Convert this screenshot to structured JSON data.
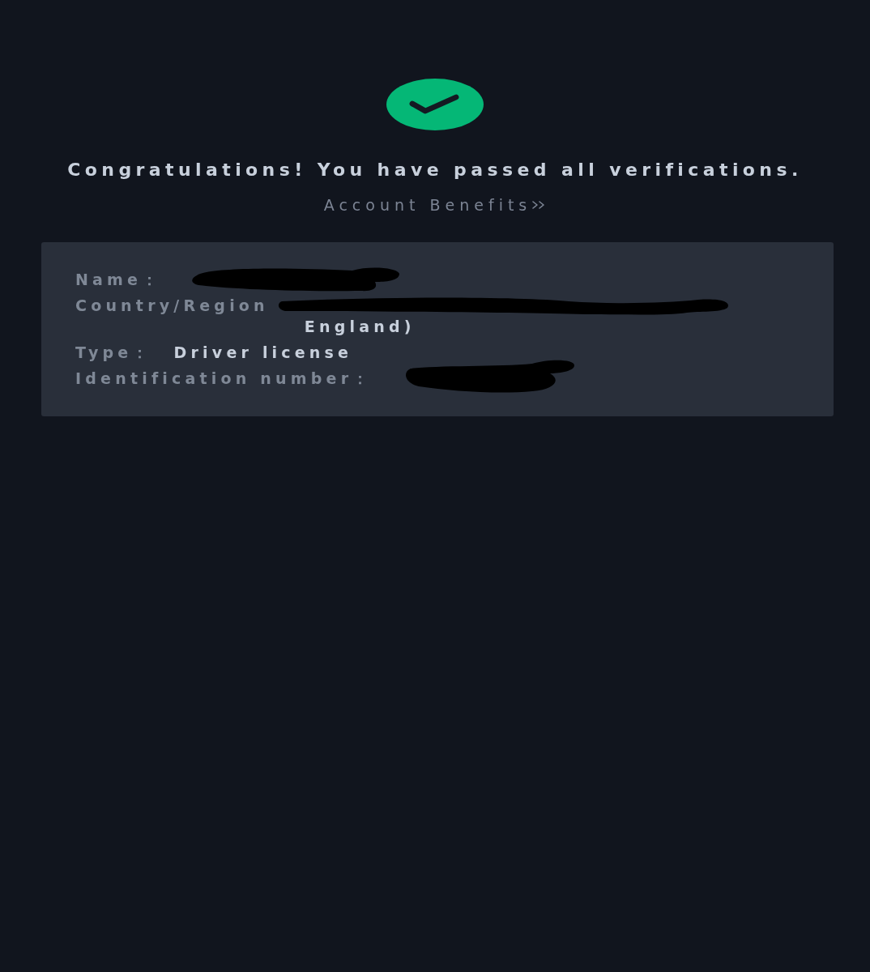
{
  "result": {
    "kind": "success",
    "title": "Congratulations! You have passed all verifications.",
    "link": "Account Benefits"
  },
  "details": [
    {
      "label": "Name：",
      "parts": [
        {
          "kind": "redacted"
        }
      ]
    },
    {
      "label": "Country/Region",
      "parts": [
        {
          "kind": "redacted"
        },
        {
          "kind": "text",
          "text": "England)"
        }
      ]
    },
    {
      "label": "Type：",
      "parts": [
        {
          "kind": "text",
          "text": "Driver license"
        }
      ]
    },
    {
      "label": "Identification number：",
      "parts": [
        {
          "kind": "redacted"
        }
      ]
    }
  ]
}
